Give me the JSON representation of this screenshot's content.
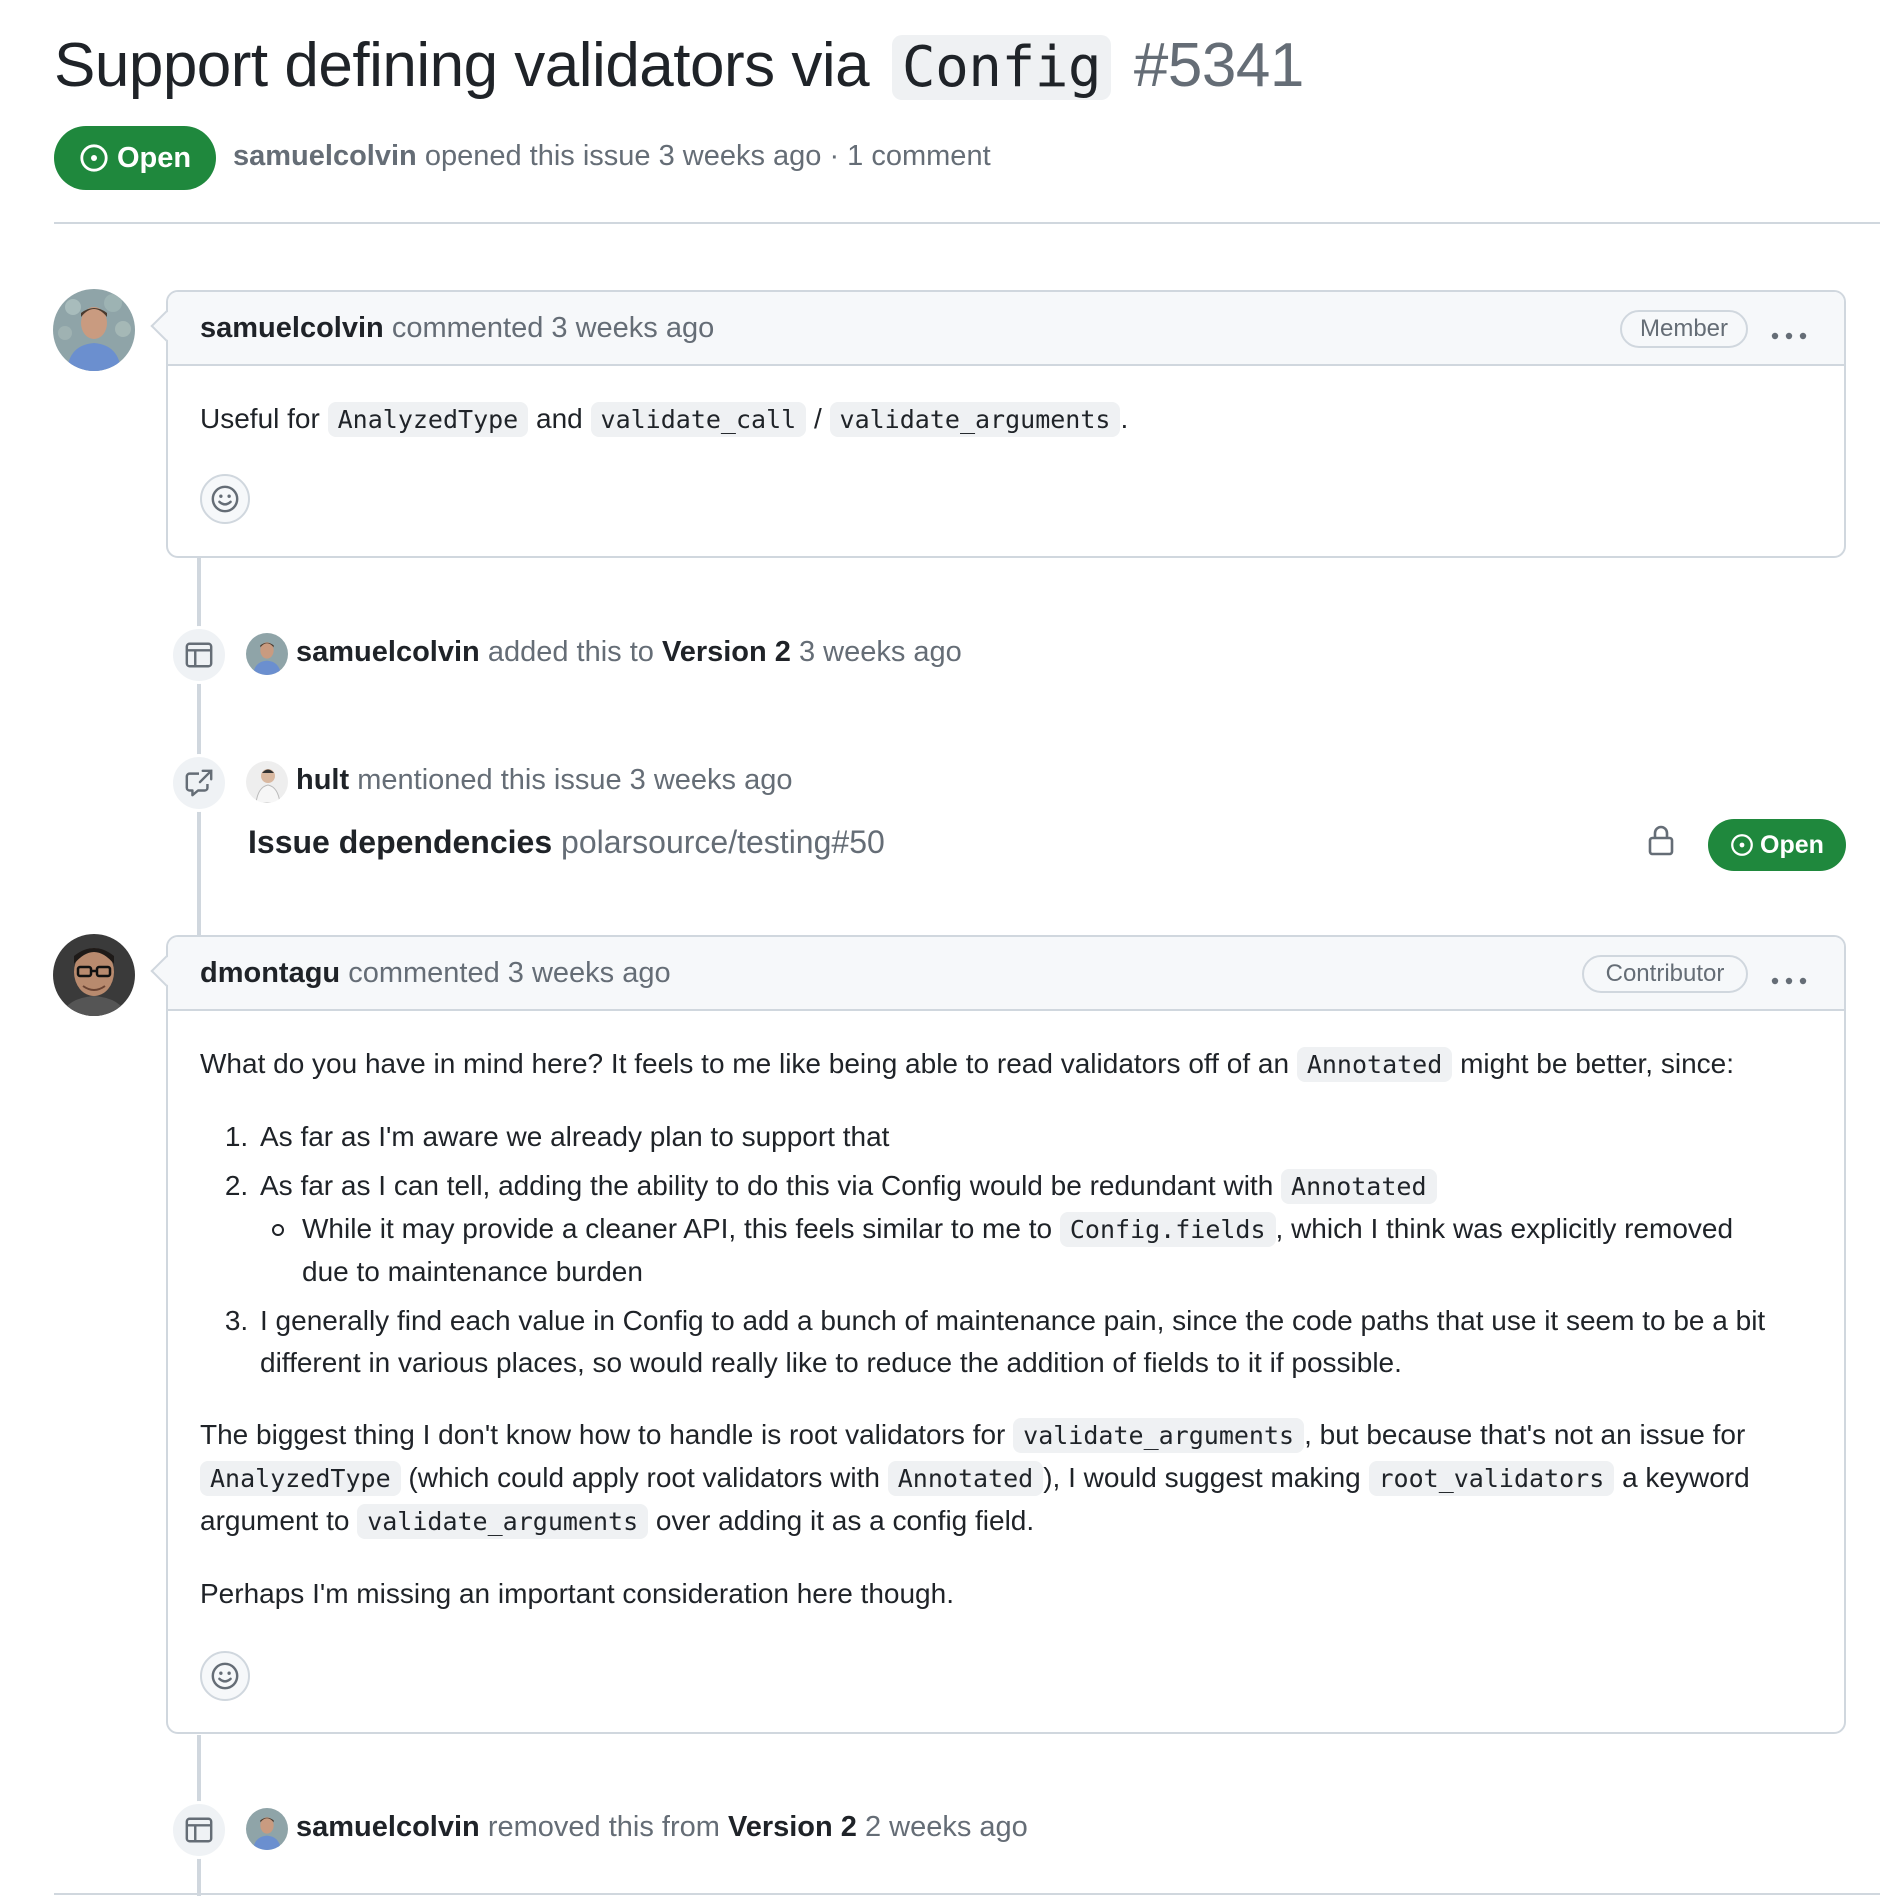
{
  "issue": {
    "title_prefix": "Support defining validators via",
    "title_code": "Config",
    "number": "#5341",
    "status": "Open",
    "author": "samuelcolvin",
    "opened_text": "opened this issue 3 weeks ago · 1 comment"
  },
  "comments": [
    {
      "author": "samuelcolvin",
      "action": "commented 3 weeks ago",
      "role": "Member",
      "body": {
        "t1": "Useful for",
        "c1": "AnalyzedType",
        "t2": "and",
        "c2": "validate_call",
        "t3": "/",
        "c3": "validate_arguments",
        "t4": "."
      }
    },
    {
      "author": "dmontagu",
      "action": "commented 3 weeks ago",
      "role": "Contributor",
      "body": {
        "p1a": "What do you have in mind here? It feels to me like being able to read validators off of an",
        "p1c": "Annotated",
        "p1b": "might be better, since:",
        "li1": "As far as I'm aware we already plan to support that",
        "li2a": "As far as I can tell, adding the ability to do this via Config would be redundant with",
        "li2c": "Annotated",
        "sub1a": "While it may provide a cleaner API, this feels similar to me to",
        "sub1c": "Config.fields",
        "sub1b": ", which I think was explicitly removed due to maintenance burden",
        "li3": "I generally find each value in Config to add a bunch of maintenance pain, since the code paths that use it seem to be a bit different in various places, so would really like to reduce the addition of fields to it if possible.",
        "p2a": "The biggest thing I don't know how to handle is root validators for",
        "p2c1": "validate_arguments",
        "p2b": ", but because that's not an issue for",
        "p2c2": "AnalyzedType",
        "p2d": "(which could apply root validators with",
        "p2c3": "Annotated",
        "p2e": "), I would suggest making",
        "p2c4": "root_validators",
        "p2f": "a keyword argument to",
        "p2c5": "validate_arguments",
        "p2g": "over adding it as a config field.",
        "p3": "Perhaps I'm missing an important consideration here though."
      }
    }
  ],
  "events": [
    {
      "icon": "project-table-icon",
      "actor": "samuelcolvin",
      "action": "added this to",
      "target": "Version 2",
      "time": "3 weeks ago"
    },
    {
      "icon": "cross-reference-icon",
      "actor": "hult",
      "action": "mentioned this issue 3 weeks ago",
      "ref_title": "Issue dependencies",
      "ref_repo": "polarsource/testing#50",
      "ref_status": "Open"
    },
    {
      "icon": "project-table-icon",
      "actor": "samuelcolvin",
      "action": "removed this from",
      "target": "Version 2",
      "time": "2 weeks ago"
    }
  ],
  "colors": {
    "open_green": "#1f883d",
    "muted_text": "#656d76",
    "border": "#d0d7de"
  }
}
